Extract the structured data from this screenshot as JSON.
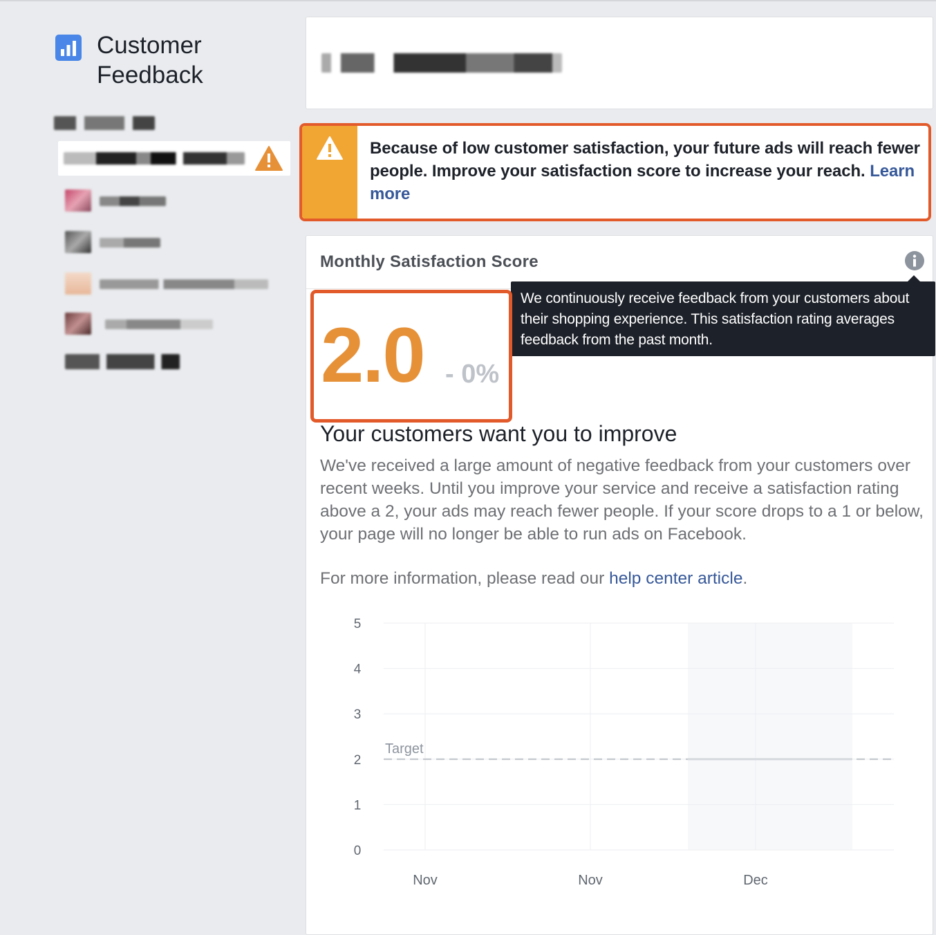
{
  "app": {
    "title": "Customer Feedback",
    "icon": "bar-chart-icon",
    "colors": {
      "accent_orange": "#e69138",
      "alert_border": "#e35a2a",
      "alert_stripe": "#f1a533",
      "link": "#365899",
      "tooltip_bg": "#1d2129"
    }
  },
  "alert": {
    "icon": "warning-icon",
    "message": "Because of low customer satisfaction, your future ads will reach fewer people. Improve your satisfaction score to increase your reach. ",
    "link_label": "Learn more"
  },
  "score_card": {
    "title": "Monthly Satisfaction Score",
    "info_icon": "info-icon",
    "tooltip": "We continuously receive feedback from your customers about their shopping experience. This satisfaction rating averages feedback from the past month.",
    "score": "2.0",
    "change": "- 0%",
    "headline": "Your customers want you to improve",
    "description": "We've received a large amount of negative feedback from your customers over recent weeks. Until you improve your service and receive a satisfaction rating above a 2, your ads may reach fewer people. If your score drops to a 1 or below, your page will no longer be able to run ads on Facebook.",
    "more_info_prefix": "For more information, please read our ",
    "more_info_link": "help center article",
    "more_info_suffix": "."
  },
  "chart_data": {
    "type": "line",
    "x_tick_labels": [
      "Nov",
      "Nov",
      "Dec"
    ],
    "y_ticks": [
      0,
      1,
      2,
      3,
      4,
      5
    ],
    "ylim": [
      0,
      5
    ],
    "target": {
      "label": "Target",
      "value": 2
    },
    "series": [
      {
        "values": [
          2.0
        ]
      }
    ],
    "grid": true
  }
}
